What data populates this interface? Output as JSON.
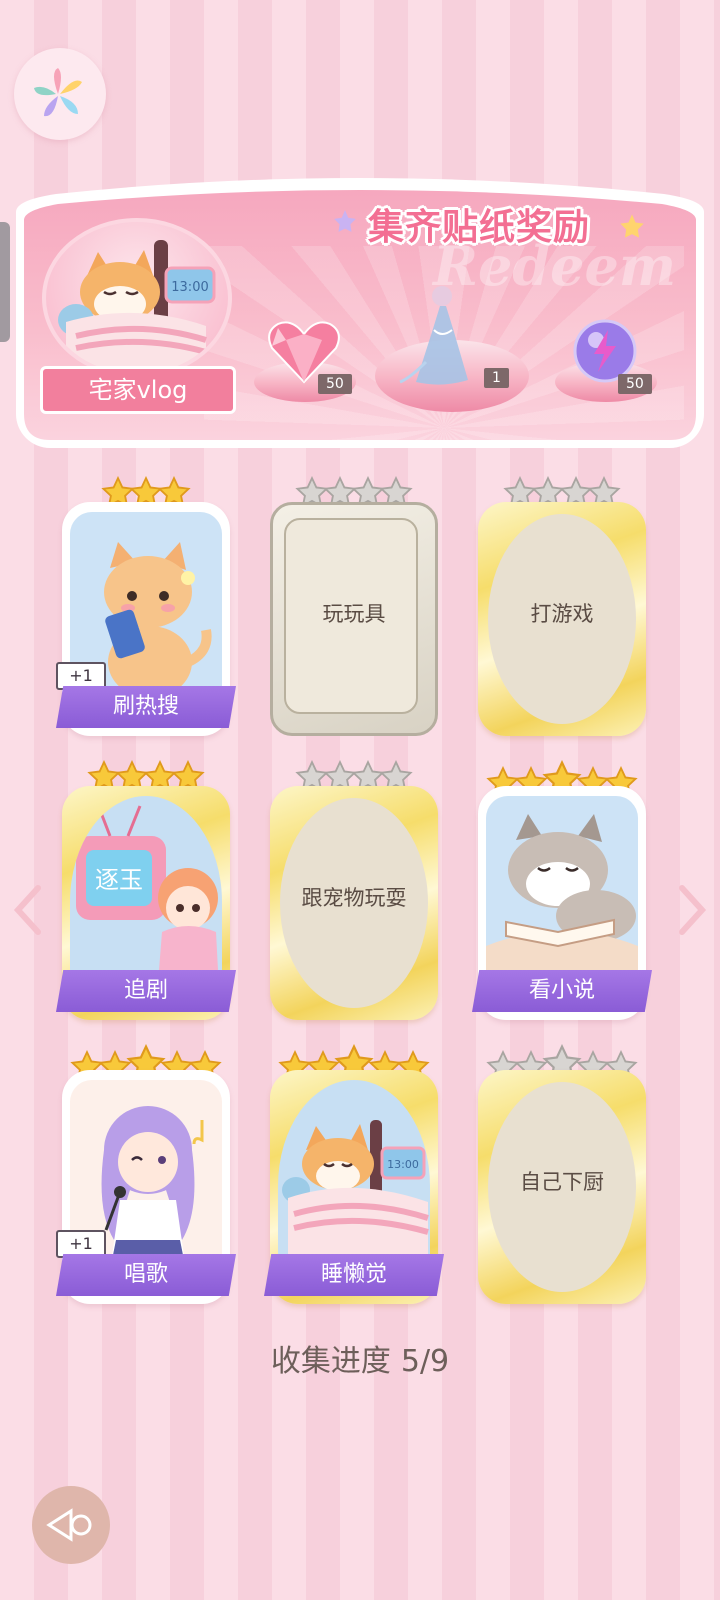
{
  "banner": {
    "title": "集齐贴纸奖励",
    "watermark": "Redeem",
    "theme_label": "宅家vlog",
    "rewards": [
      {
        "icon": "pink-heart-gem-icon",
        "count": "50"
      },
      {
        "icon": "dress-costume-icon",
        "count": "1"
      },
      {
        "icon": "purple-lightning-orb-icon",
        "count": "50"
      }
    ]
  },
  "cards": [
    {
      "label": "刷热搜",
      "stars": 3,
      "collected": true,
      "badge": "+1"
    },
    {
      "label": "玩玩具",
      "stars": 4,
      "collected": false
    },
    {
      "label": "打游戏",
      "stars": 4,
      "collected": false
    },
    {
      "label": "追剧",
      "stars": 4,
      "collected": true,
      "tv_text": "逐玉"
    },
    {
      "label": "跟宠物玩耍",
      "stars": 4,
      "collected": false
    },
    {
      "label": "看小说",
      "stars": 5,
      "collected": true
    },
    {
      "label": "唱歌",
      "stars": 5,
      "collected": true,
      "badge": "+1"
    },
    {
      "label": "睡懒觉",
      "stars": 5,
      "collected": true
    },
    {
      "label": "自己下厨",
      "stars": 5,
      "collected": false
    }
  ],
  "progress": {
    "label": "收集进度",
    "value": "5/9"
  },
  "colors": {
    "accent_pink": "#f36f93",
    "label_purple": "#8a5cd6",
    "gold_frame": "#f6dd6b"
  }
}
